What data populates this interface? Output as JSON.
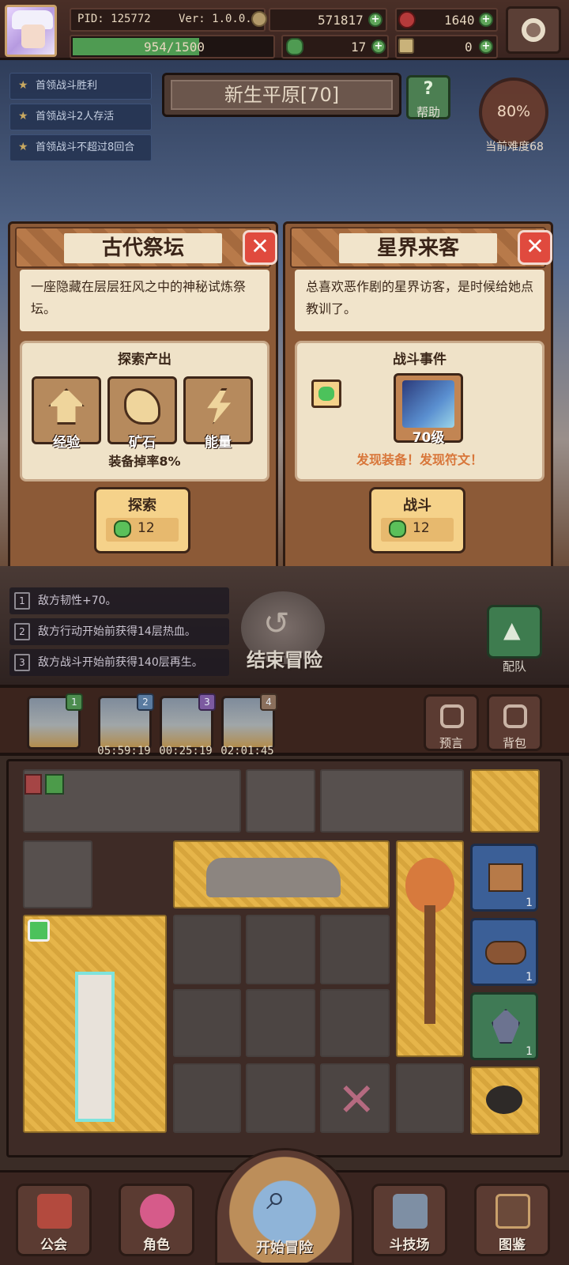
{
  "header": {
    "pid": "PID: 125772",
    "version": "Ver: 1.0.0.1",
    "coins": "571817",
    "gems": "1640",
    "exp": "954/1500",
    "exp_fraction": 0.636,
    "clovers": "17",
    "keys": "0"
  },
  "quests": [
    "首领战斗胜利",
    "首领战斗2人存活",
    "首领战斗不超过8回合"
  ],
  "location": {
    "name": "新生平原[70]",
    "help_label": "帮助"
  },
  "difficulty": {
    "percent": "80%",
    "label": "当前难度68"
  },
  "cards": [
    {
      "title": "古代祭坛",
      "desc": "一座隐藏在层层狂风之中的神秘试炼祭坛。",
      "panel_title": "探索产出",
      "rewards": [
        {
          "label": "经验",
          "icon": "exp-arrow-icon"
        },
        {
          "label": "矿石",
          "icon": "ore-icon"
        },
        {
          "label": "能量",
          "icon": "lightning-icon"
        }
      ],
      "drop": "装备掉率8%",
      "action": "探索",
      "cost": "12"
    },
    {
      "title": "星界来客",
      "desc": "总喜欢恶作剧的星界访客，是时候给她点教训了。",
      "panel_title": "战斗事件",
      "enemy_level": "70级",
      "find": "发现装备！发现符文！",
      "action": "战斗",
      "cost": "12"
    }
  ],
  "buffs": [
    {
      "num": "1",
      "text": "敌方韧性+70。"
    },
    {
      "num": "2",
      "text": "敌方行动开始前获得14层热血。"
    },
    {
      "num": "3",
      "text": "敌方战斗开始前获得140层再生。"
    }
  ],
  "end_label": "结束冒险",
  "team_label": "配队",
  "slots": [
    {
      "badge": "1",
      "timer": ""
    },
    {
      "badge": "2",
      "timer": "05:59:19"
    },
    {
      "badge": "3",
      "timer": "00:25:19"
    },
    {
      "badge": "4",
      "timer": "02:01:45"
    }
  ],
  "side_buttons": {
    "prophecy": "预言",
    "bag": "背包"
  },
  "inventory_counts": [
    "1",
    "1",
    "1"
  ],
  "nav": {
    "guild": "公会",
    "role": "角色",
    "start": "开始冒险",
    "arena": "斗技场",
    "codex": "图鉴"
  },
  "colors": {
    "accent_gold": "#e6b54a",
    "gem_green": "#5bc05a",
    "close_red": "#e04a3e",
    "find_orange": "#d8763a"
  }
}
